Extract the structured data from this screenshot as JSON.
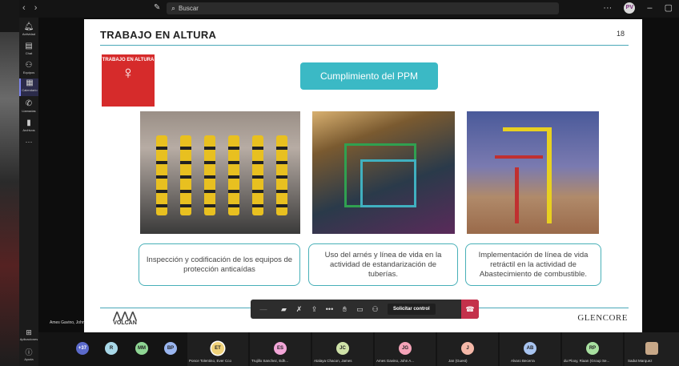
{
  "app": {
    "search_placeholder": "Buscar",
    "profile_initials": "PV",
    "nav_back": "‹",
    "nav_forward": "›",
    "more": "···",
    "minimize": "–",
    "maximize": "▢"
  },
  "rail": {
    "items": [
      {
        "label": "Actividad",
        "icon": "bell-icon"
      },
      {
        "label": "Chat",
        "icon": "chat-icon"
      },
      {
        "label": "Equipos",
        "icon": "teams-icon"
      },
      {
        "label": "Calendario",
        "icon": "calendar-icon"
      },
      {
        "label": "Llamadas",
        "icon": "phone-icon"
      },
      {
        "label": "Archivos",
        "icon": "file-icon"
      }
    ],
    "more": "···",
    "apps_label": "Aplicaciones",
    "help_label": "Ayuda"
  },
  "slide": {
    "title": "TRABAJO EN ALTURA",
    "page_number": "18",
    "logo_text": "TRABAJO EN ALTURA",
    "banner": "Cumplimiento del PPM",
    "captions": [
      "Inspección y codificación de los equipos de protección anticaídas",
      "Uso del arnés y línea de vida en la actividad de estandarización de tuberías.",
      "Implementación de línea de vida retráctil en la actividad de Abastecimiento de combustible."
    ],
    "volcan_logo": "VOLCAN",
    "glencore_logo": "GLENCORE"
  },
  "presenter_name": "Ames Gavino, John",
  "toolbar": {
    "request_control": "Solicitar control"
  },
  "participants": [
    {
      "initials": "+37",
      "name": "",
      "color": "#5b6acb"
    },
    {
      "initials": "R",
      "name": "",
      "color": "#a8d8e8"
    },
    {
      "initials": "MM",
      "name": "",
      "color": "#8fd694"
    },
    {
      "initials": "BP",
      "name": "",
      "color": "#9ab6f0"
    },
    {
      "initials": "ET",
      "name": "Ponce Tolentino, Ever Cco",
      "color": "#f0d27a"
    },
    {
      "initials": "ES",
      "name": "Trujillo Sanchez, Edh...",
      "color": "#f3a6d8"
    },
    {
      "initials": "JC",
      "name": "Atalaya Chacon, James",
      "color": "#cfe2a8"
    },
    {
      "initials": "JG",
      "name": "Ames Gavino, John A...",
      "color": "#f5a3b8"
    },
    {
      "initials": "J",
      "name": "Jan (Guest)",
      "color": "#f5b8a8"
    },
    {
      "initials": "AB",
      "name": "Alvaro Becerra",
      "color": "#a8c4f0"
    },
    {
      "initials": "RP",
      "name": "du Plooy, Riaan (Group Se...",
      "color": "#a8e0a0"
    },
    {
      "initials": "",
      "name": "Sadut Marquez",
      "color": "#c8a888"
    }
  ]
}
